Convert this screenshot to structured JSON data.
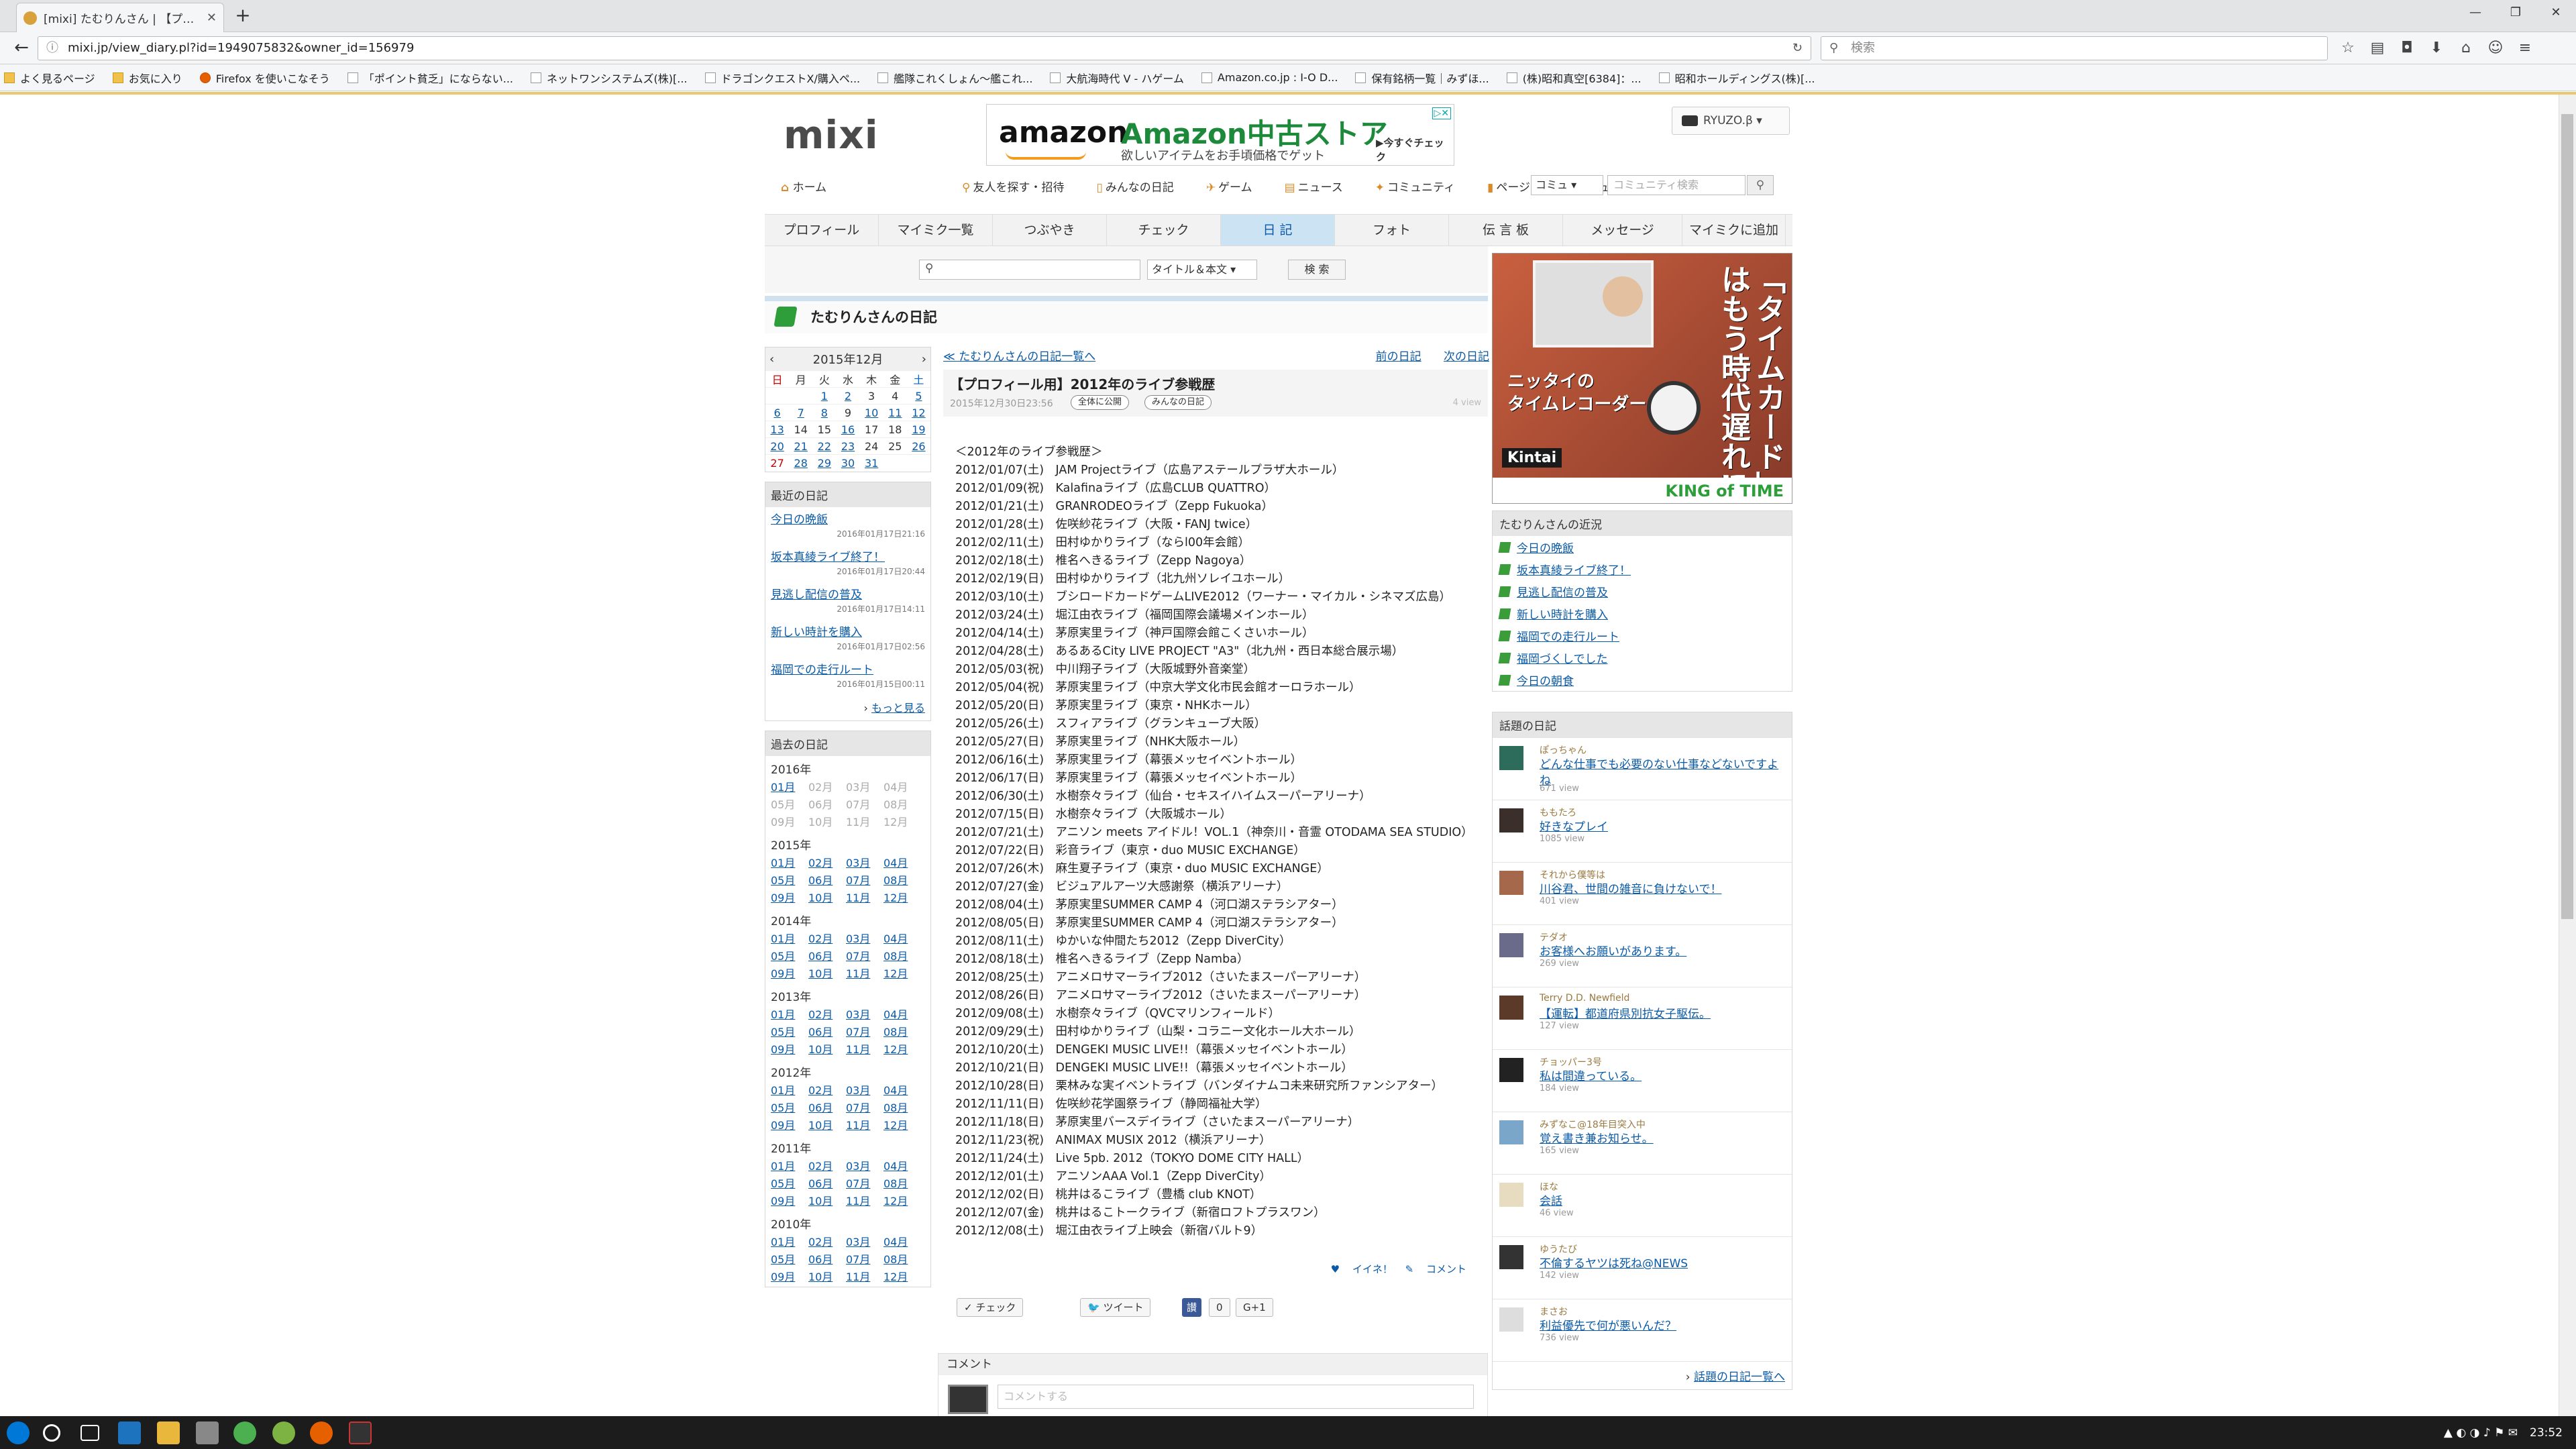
{
  "browser": {
    "tab_title": "[mixi] たむりんさん | 【プロフィ...",
    "url": "mixi.jp/view_diary.pl?id=1949075832&owner_id=156979",
    "search_placeholder": "検索",
    "bookmarks": [
      "よく見るページ",
      "お気に入り",
      "Firefox を使いこなそう",
      "「ポイント貧乏」にならない...",
      "ネットワンシステムズ(株)[...",
      "ドラゴンクエストX/購入ペ...",
      "艦隊これくしょん～艦これ...",
      "大航海時代 V - ハゲーム",
      "Amazon.co.jp : I-O D...",
      "保有銘柄一覧｜みずほ...",
      "(株)昭和真空[6384]：...",
      "昭和ホールディングス(株)[..."
    ]
  },
  "header": {
    "logo": "mixi",
    "user_label": "RYUZO.β ▾",
    "ad": {
      "brand": "amazon",
      "store": "Amazon中古ストア",
      "sub": "欲しいアイテムをお手頃価格でゲット",
      "cta": "▶今すぐチェック"
    }
  },
  "gnav": {
    "home": "ホーム",
    "links": [
      "友人を探す・招待",
      "みんなの日記",
      "ゲーム",
      "ニュース",
      "コミュニティ",
      "ページ",
      "レビュー"
    ],
    "select": "コミュ",
    "search_placeholder": "コミュニティ検索"
  },
  "tabs": [
    "プロフィール",
    "マイミク一覧",
    "つぶやき",
    "チェック",
    "日 記",
    "フォト",
    "伝 言 板",
    "メッセージ",
    "マイミクに追加"
  ],
  "diary_search": {
    "select": "タイトル＆本文",
    "button": "検 索"
  },
  "diary_owner_title": "たむりんさんの日記",
  "calendar": {
    "month": "2015年12月",
    "weekdays": [
      "日",
      "月",
      "火",
      "水",
      "木",
      "金",
      "土"
    ],
    "weeks": [
      [
        "",
        "",
        "1",
        "2",
        "3",
        "4",
        "5"
      ],
      [
        "6",
        "7",
        "8",
        "9",
        "10",
        "11",
        "12"
      ],
      [
        "13",
        "14",
        "15",
        "16",
        "17",
        "18",
        "19"
      ],
      [
        "20",
        "21",
        "22",
        "23",
        "24",
        "25",
        "26"
      ],
      [
        "27",
        "28",
        "29",
        "30",
        "31",
        "",
        ""
      ]
    ],
    "linked": [
      "1",
      "2",
      "5",
      "6",
      "7",
      "8",
      "10",
      "11",
      "12",
      "13",
      "16",
      "19",
      "20",
      "21",
      "22",
      "23",
      "26",
      "28",
      "29",
      "30",
      "31"
    ]
  },
  "recent": {
    "title": "最近の日記",
    "items": [
      {
        "t": "今日の晩飯",
        "d": "2016年01月17日21:16"
      },
      {
        "t": "坂本真綾ライブ終了！",
        "d": "2016年01月17日20:44"
      },
      {
        "t": "見逃し配信の普及",
        "d": "2016年01月17日14:11"
      },
      {
        "t": "新しい時計を購入",
        "d": "2016年01月17日02:56"
      },
      {
        "t": "福岡での走行ルート",
        "d": "2016年01月15日00:11"
      }
    ],
    "more": "もっと見る"
  },
  "past": {
    "title": "過去の日記",
    "years": [
      {
        "y": "2016年",
        "m": [
          "01月",
          "02月",
          "03月",
          "04月",
          "05月",
          "06月",
          "07月",
          "08月",
          "09月",
          "10月",
          "11月",
          "12月"
        ],
        "linked": 1
      },
      {
        "y": "2015年",
        "m": [
          "01月",
          "02月",
          "03月",
          "04月",
          "05月",
          "06月",
          "07月",
          "08月",
          "09月",
          "10月",
          "11月",
          "12月"
        ],
        "linked": 12
      },
      {
        "y": "2014年",
        "m": [
          "01月",
          "02月",
          "03月",
          "04月",
          "05月",
          "06月",
          "07月",
          "08月",
          "09月",
          "10月",
          "11月",
          "12月"
        ],
        "linked": 12
      },
      {
        "y": "2013年",
        "m": [
          "01月",
          "02月",
          "03月",
          "04月",
          "05月",
          "06月",
          "07月",
          "08月",
          "09月",
          "10月",
          "11月",
          "12月"
        ],
        "linked": 12
      },
      {
        "y": "2012年",
        "m": [
          "01月",
          "02月",
          "03月",
          "04月",
          "05月",
          "06月",
          "07月",
          "08月",
          "09月",
          "10月",
          "11月",
          "12月"
        ],
        "linked": 12
      },
      {
        "y": "2011年",
        "m": [
          "01月",
          "02月",
          "03月",
          "04月",
          "05月",
          "06月",
          "07月",
          "08月",
          "09月",
          "10月",
          "11月",
          "12月"
        ],
        "linked": 12
      },
      {
        "y": "2010年",
        "m": [
          "01月",
          "02月",
          "03月",
          "04月",
          "05月",
          "06月",
          "07月",
          "08月",
          "09月",
          "10月",
          "11月",
          "12月"
        ],
        "linked": 12
      }
    ]
  },
  "diary": {
    "back": "≪ たむりんさんの日記一覧へ",
    "prev": "前の日記",
    "next": "次の日記",
    "title": "【プロフィール用】2012年のライブ参戦歴",
    "date": "2015年12月30日23:56",
    "badge1": "全体に公開",
    "badge2": "みんなの日記",
    "views": "4 view",
    "lines": [
      "＜2012年のライブ参戦歴＞",
      "2012/01/07(土)　JAM Projectライブ（広島アステールプラザ大ホール）",
      "2012/01/09(祝)　Kalafinaライブ（広島CLUB QUATTRO）",
      "2012/01/21(土)　GRANRODEOライブ（Zepp Fukuoka）",
      "2012/01/28(土)　佐咲紗花ライブ（大阪・FANJ twice）",
      "2012/02/11(土)　田村ゆかりライブ（ならl00年会館）",
      "2012/02/18(土)　椎名へきるライブ（Zepp Nagoya）",
      "2012/02/19(日)　田村ゆかりライブ（北九州ソレイユホール）",
      "2012/03/10(土)　ブシロードカードゲームLIVE2012（ワーナー・マイカル・シネマズ広島）",
      "2012/03/24(土)　堀江由衣ライブ（福岡国際会議場メインホール）",
      "2012/04/14(土)　茅原実里ライブ（神戸国際会館こくさいホール）",
      "2012/04/28(土)　あるあるCity LIVE PROJECT \"A3\"（北九州・西日本総合展示場）",
      "2012/05/03(祝)　中川翔子ライブ（大阪城野外音楽堂）",
      "2012/05/04(祝)　茅原実里ライブ（中京大学文化市民会館オーロラホール）",
      "2012/05/20(日)　茅原実里ライブ（東京・NHKホール）",
      "2012/05/26(土)　スフィアライブ（グランキューブ大阪）",
      "2012/05/27(日)　茅原実里ライブ（NHK大阪ホール）",
      "2012/06/16(土)　茅原実里ライブ（幕張メッセイベントホール）",
      "2012/06/17(日)　茅原実里ライブ（幕張メッセイベントホール）",
      "2012/06/30(土)　水樹奈々ライブ（仙台・セキスイハイムスーパーアリーナ）",
      "2012/07/15(日)　水樹奈々ライブ（大阪城ホール）",
      "2012/07/21(土)　アニソン meets アイドル！VOL.1（神奈川・音霊 OTODAMA SEA STUDIO）",
      "2012/07/22(日)　彩音ライブ（東京・duo MUSIC EXCHANGE）",
      "2012/07/26(木)　麻生夏子ライブ（東京・duo MUSIC EXCHANGE）",
      "2012/07/27(金)　ビジュアルアーツ大感謝祭（横浜アリーナ）",
      "2012/08/04(土)　茅原実里SUMMER CAMP 4（河口湖ステラシアター）",
      "2012/08/05(日)　茅原実里SUMMER CAMP 4（河口湖ステラシアター）",
      "2012/08/11(土)　ゆかいな仲間たち2012（Zepp DiverCity）",
      "2012/08/18(土)　椎名へきるライブ（Zepp Namba）",
      "2012/08/25(土)　アニメロサマーライブ2012（さいたまスーパーアリーナ）",
      "2012/08/26(日)　アニメロサマーライブ2012（さいたまスーパーアリーナ）",
      "2012/09/08(土)　水樹奈々ライブ（QVCマリンフィールド）",
      "2012/09/29(土)　田村ゆかりライブ（山梨・コラニー文化ホール大ホール）",
      "2012/10/20(土)　DENGEKI MUSIC LIVE!!（幕張メッセイベントホール）",
      "2012/10/21(日)　DENGEKI MUSIC LIVE!!（幕張メッセイベントホール）",
      "2012/10/28(日)　栗林みな実イベントライブ（バンダイナムコ未来研究所ファンシアター）",
      "2012/11/11(日)　佐咲紗花学園祭ライブ（静岡福祉大学）",
      "2012/11/18(日)　茅原実里バースデイライブ（さいたまスーパーアリーナ）",
      "2012/11/23(祝)　ANIMAX MUSIX 2012（横浜アリーナ）",
      "2012/11/24(土)　Live 5pb. 2012（TOKYO DOME CITY HALL）",
      "2012/12/01(土)　アニソンAAA Vol.1（Zepp DiverCity）",
      "2012/12/02(日)　桃井はるこライブ（豊橋 club KNOT）",
      "2012/12/07(金)　桃井はるこトークライブ（新宿ロフトプラスワン）",
      "2012/12/08(土)　堀江由衣ライブ上映会（新宿バルト9）"
    ],
    "iine": "イイネ！",
    "comment_link": "コメント",
    "check": "チェック",
    "tweet": "ツイート",
    "like_count": "0",
    "gplus": "G+1"
  },
  "comment": {
    "title": "コメント",
    "placeholder": "コメントする"
  },
  "kinkyo": {
    "title": "たむりんさんの近況",
    "items": [
      "今日の晩飯",
      "坂本真綾ライブ終了！",
      "見逃し配信の普及",
      "新しい時計を購入",
      "福岡での走行ルート",
      "福岡づくしでした",
      "今日の朝食"
    ]
  },
  "right_ad": {
    "caption": "ニッタイの\nタイムレコーダー",
    "vertical": "「タイムカード」はもう時代遅れ!?",
    "kintai": "Kintai",
    "brand": "KING of TIME"
  },
  "wadai": {
    "title": "話題の日記",
    "items": [
      {
        "u": "ぽっちゃん",
        "t": "どんな仕事でも必要のない仕事などないですよね",
        "v": "671 view"
      },
      {
        "u": "ももたろ",
        "t": "好きなプレイ",
        "v": "1085 view"
      },
      {
        "u": "それから僕等は",
        "t": "川谷君、世間の雑音に負けないで！",
        "v": "401 view"
      },
      {
        "u": "テダオ",
        "t": "お客様へお願いがあります。",
        "v": "269 view"
      },
      {
        "u": "Terry D.D. Newfield",
        "t": "【運転】都道府県別抗女子駆伝。",
        "v": "127 view"
      },
      {
        "u": "チョッパー3号",
        "t": "私は間違っている。",
        "v": "184 view"
      },
      {
        "u": "みずなこ@18年目突入中",
        "t": "覚え書き兼お知らせ。",
        "v": "165 view"
      },
      {
        "u": "ほな",
        "t": "会話",
        "v": "46 view"
      },
      {
        "u": "ゆうたび",
        "t": "不倫するヤツは死ね@NEWS",
        "v": "142 view"
      },
      {
        "u": "まさお",
        "t": "利益優先で何が悪いんだ？",
        "v": "736 view"
      }
    ],
    "foot": "話題の日記一覧へ"
  },
  "taskbar": {
    "clock": "23:52"
  }
}
